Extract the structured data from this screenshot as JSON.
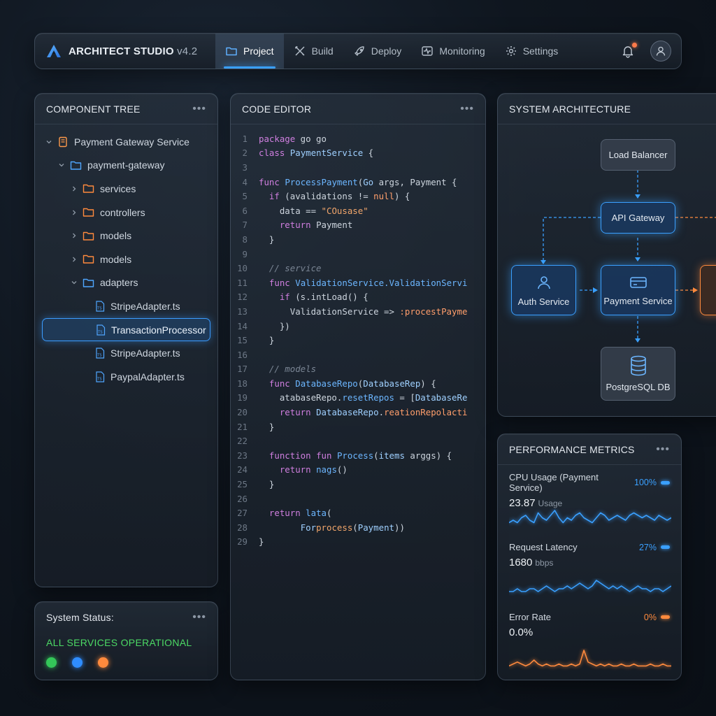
{
  "app": {
    "title": "ARCHITECT STUDIO",
    "version": "v4.2",
    "accent": "#3aa0ff"
  },
  "nav": [
    {
      "label": "Project",
      "icon": "folder-icon",
      "active": true
    },
    {
      "label": "Build",
      "icon": "tools-icon"
    },
    {
      "label": "Deploy",
      "icon": "rocket-icon"
    },
    {
      "label": "Monitoring",
      "icon": "pulse-icon"
    },
    {
      "label": "Settings",
      "icon": "gear-icon"
    }
  ],
  "tree": {
    "title": "COMPONENT TREE",
    "menu": "•••",
    "items": [
      {
        "label": "Payment Gateway Service",
        "level": 0,
        "chevron": "down",
        "icon": "service-icon"
      },
      {
        "label": "payment-gateway",
        "level": 1,
        "chevron": "down",
        "icon": "folder-icon"
      },
      {
        "label": "services",
        "level": 2,
        "chevron": "right",
        "icon": "folder-icon"
      },
      {
        "label": "controllers",
        "level": 2,
        "chevron": "right",
        "icon": "folder-icon"
      },
      {
        "label": "models",
        "level": 2,
        "chevron": "right",
        "icon": "folder-icon"
      },
      {
        "label": "models",
        "level": 2,
        "chevron": "right",
        "icon": "folder-icon"
      },
      {
        "label": "adapters",
        "level": 2,
        "chevron": "down",
        "icon": "folder-icon"
      },
      {
        "label": "StripeAdapter.ts",
        "level": 3,
        "icon": "ts-file-icon"
      },
      {
        "label": "TransactionProcessor",
        "level": 3,
        "icon": "ts-file-icon",
        "selected": true
      },
      {
        "label": "StripeAdapter.ts",
        "level": 3,
        "icon": "ts-file-icon"
      },
      {
        "label": "PaypalAdapter.ts",
        "level": 3,
        "icon": "ts-file-icon"
      }
    ]
  },
  "status": {
    "title": "System Status:",
    "menu": "•••",
    "text": "ALL SERVICES OPERATIONAL",
    "dots": [
      "#34c759",
      "#2f8dff",
      "#ff8a3d"
    ]
  },
  "editor": {
    "title": "CODE EDITOR",
    "menu": "•••",
    "lines": [
      [
        [
          "k",
          "package"
        ],
        [
          "ct",
          " go go"
        ]
      ],
      [
        [
          "k",
          "class"
        ],
        [
          "ct",
          " "
        ],
        [
          "t",
          "PaymentService"
        ],
        [
          "ct",
          " {"
        ]
      ],
      [],
      [
        [
          "k",
          "func"
        ],
        [
          "ct",
          " "
        ],
        [
          "f",
          "ProcessPayment"
        ],
        [
          "ct",
          "("
        ],
        [
          "t",
          "Go"
        ],
        [
          "ct",
          " args, Payment {"
        ]
      ],
      [
        [
          "ct",
          "  "
        ],
        [
          "k",
          "if"
        ],
        [
          "ct",
          " (avalidations != "
        ],
        [
          "o",
          "null"
        ],
        [
          "ct",
          ") {"
        ]
      ],
      [
        [
          "ct",
          "    data == "
        ],
        [
          "s",
          "\"COusase\""
        ]
      ],
      [
        [
          "ct",
          "    "
        ],
        [
          "k",
          "return"
        ],
        [
          "ct",
          " Payment"
        ]
      ],
      [
        [
          "ct",
          "  }"
        ]
      ],
      [],
      [
        [
          "c",
          "  // service"
        ]
      ],
      [
        [
          "ct",
          "  "
        ],
        [
          "k",
          "func"
        ],
        [
          "ct",
          " "
        ],
        [
          "f",
          "ValidationService.ValidationServi"
        ]
      ],
      [
        [
          "ct",
          "    "
        ],
        [
          "k",
          "if"
        ],
        [
          "ct",
          " (s.intLoad() {"
        ]
      ],
      [
        [
          "ct",
          "      ValidationService => "
        ],
        [
          "o",
          ":procestPayme"
        ]
      ],
      [
        [
          "ct",
          "    })"
        ]
      ],
      [
        [
          "ct",
          "  }"
        ]
      ],
      [],
      [
        [
          "c",
          "  // models"
        ]
      ],
      [
        [
          "ct",
          "  "
        ],
        [
          "k",
          "func"
        ],
        [
          "ct",
          " "
        ],
        [
          "f",
          "DatabaseRepo"
        ],
        [
          "ct",
          "("
        ],
        [
          "t",
          "DatabaseRep"
        ],
        [
          "ct",
          ") {"
        ]
      ],
      [
        [
          "ct",
          "    atabaseRepo."
        ],
        [
          "f",
          "resetRepos"
        ],
        [
          "ct",
          " = ["
        ],
        [
          "t",
          "DatabaseRe"
        ]
      ],
      [
        [
          "ct",
          "    "
        ],
        [
          "k",
          "return"
        ],
        [
          "ct",
          " "
        ],
        [
          "t",
          "DatabaseRepo"
        ],
        [
          "ct",
          "."
        ],
        [
          "o",
          "reationRepolacti"
        ]
      ],
      [
        [
          "ct",
          "  }"
        ]
      ],
      [],
      [
        [
          "ct",
          "  "
        ],
        [
          "k",
          "function"
        ],
        [
          "ct",
          " "
        ],
        [
          "k",
          "fun"
        ],
        [
          "ct",
          " "
        ],
        [
          "f",
          "Process"
        ],
        [
          "ct",
          "("
        ],
        [
          "t",
          "items"
        ],
        [
          "ct",
          " arggs) {"
        ]
      ],
      [
        [
          "ct",
          "    "
        ],
        [
          "k",
          "return"
        ],
        [
          "ct",
          " "
        ],
        [
          "f",
          "nags"
        ],
        [
          "ct",
          "()"
        ]
      ],
      [
        [
          "ct",
          "  }"
        ]
      ],
      [],
      [
        [
          "ct",
          "  "
        ],
        [
          "k",
          "return"
        ],
        [
          "ct",
          " "
        ],
        [
          "f",
          "lata"
        ],
        [
          "ct",
          "("
        ]
      ],
      [
        [
          "ct",
          "        "
        ],
        [
          "t",
          "For"
        ],
        [
          "s",
          "process"
        ],
        [
          "ct",
          "("
        ],
        [
          "t",
          "Payment"
        ],
        [
          "ct",
          "))"
        ]
      ],
      [
        [
          "ct",
          "}"
        ]
      ]
    ]
  },
  "arch": {
    "title": "SYSTEM ARCHITECTURE",
    "nodes": {
      "lb": "Load Balancer",
      "api": "API Gateway",
      "auth": "Auth Service",
      "payment": "Payment Service",
      "db": "PostgreSQL DB"
    }
  },
  "metrics": {
    "title": "PERFORMANCE METRICS",
    "menu": "•••",
    "items": [
      {
        "label": "CPU Usage (Payment Service)",
        "pct": "100%",
        "value": "23.87",
        "unit": "Usage",
        "color": "#3aa0ff",
        "series": [
          3,
          4,
          3,
          5,
          6,
          4,
          3,
          7,
          5,
          4,
          6,
          8,
          5,
          3,
          5,
          4,
          6,
          7,
          5,
          4,
          3,
          5,
          7,
          6,
          4,
          5,
          6,
          5,
          4,
          6,
          7,
          6,
          5,
          6,
          5,
          4,
          6,
          5,
          4,
          5
        ]
      },
      {
        "label": "Request Latency",
        "pct": "27%",
        "value": "1680",
        "unit": "bbps",
        "color": "#3aa0ff",
        "series": [
          3,
          3,
          4,
          3,
          3,
          4,
          4,
          3,
          4,
          5,
          4,
          3,
          4,
          4,
          5,
          4,
          5,
          6,
          5,
          4,
          5,
          7,
          6,
          5,
          4,
          5,
          4,
          5,
          4,
          3,
          4,
          5,
          4,
          4,
          3,
          4,
          4,
          3,
          4,
          5
        ]
      },
      {
        "label": "Error Rate",
        "pct": "0%",
        "value": "0.0%",
        "unit": "",
        "color": "#ff8a3d",
        "series": [
          2,
          3,
          4,
          3,
          2,
          3,
          5,
          3,
          2,
          3,
          2,
          2,
          3,
          2,
          2,
          3,
          2,
          3,
          10,
          4,
          3,
          2,
          3,
          2,
          3,
          2,
          2,
          3,
          2,
          2,
          3,
          2,
          2,
          2,
          3,
          2,
          2,
          3,
          2,
          2
        ]
      }
    ]
  }
}
